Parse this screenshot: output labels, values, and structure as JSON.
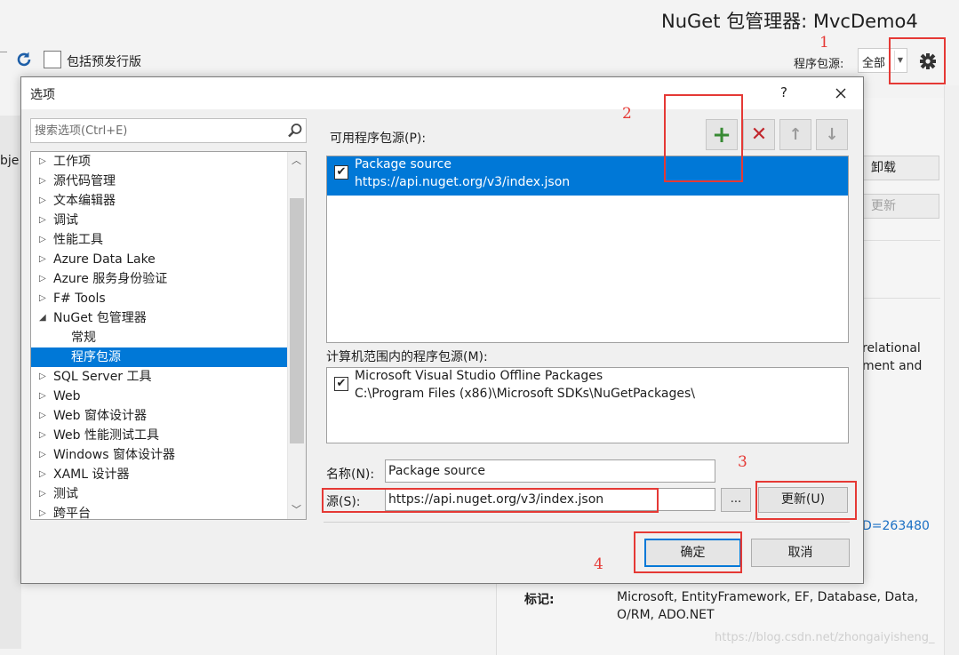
{
  "background": {
    "title": "NuGet 包管理器: MvcDemo4",
    "include_prerelease_label": "包括预发行版",
    "package_source_label": "程序包源:",
    "package_source_value": "全部",
    "left_text_fragment": "bje",
    "uninstall_label": "卸载",
    "update_label": "更新",
    "desc_line1": "relational",
    "desc_line2": "ment and",
    "link_fragment": "D=263480",
    "tags_label": "标记:",
    "tags_line1": "Microsoft, EntityFramework, EF, Database, Data,",
    "tags_line2": "O/RM, ADO.NET"
  },
  "dialog": {
    "title": "选项",
    "help": "?",
    "search_placeholder": "搜索选项(Ctrl+E)",
    "tree": [
      {
        "label": "工作项",
        "arrow": "▷",
        "child": false,
        "selected": false
      },
      {
        "label": "源代码管理",
        "arrow": "▷",
        "child": false,
        "selected": false
      },
      {
        "label": "文本编辑器",
        "arrow": "▷",
        "child": false,
        "selected": false
      },
      {
        "label": "调试",
        "arrow": "▷",
        "child": false,
        "selected": false
      },
      {
        "label": "性能工具",
        "arrow": "▷",
        "child": false,
        "selected": false
      },
      {
        "label": "Azure Data Lake",
        "arrow": "▷",
        "child": false,
        "selected": false
      },
      {
        "label": "Azure 服务身份验证",
        "arrow": "▷",
        "child": false,
        "selected": false
      },
      {
        "label": "F# Tools",
        "arrow": "▷",
        "child": false,
        "selected": false
      },
      {
        "label": "NuGet 包管理器",
        "arrow": "◢",
        "child": false,
        "selected": false
      },
      {
        "label": "常规",
        "arrow": "",
        "child": true,
        "selected": false
      },
      {
        "label": "程序包源",
        "arrow": "",
        "child": true,
        "selected": true
      },
      {
        "label": "SQL Server 工具",
        "arrow": "▷",
        "child": false,
        "selected": false
      },
      {
        "label": "Web",
        "arrow": "▷",
        "child": false,
        "selected": false
      },
      {
        "label": "Web 窗体设计器",
        "arrow": "▷",
        "child": false,
        "selected": false
      },
      {
        "label": "Web 性能测试工具",
        "arrow": "▷",
        "child": false,
        "selected": false
      },
      {
        "label": "Windows 窗体设计器",
        "arrow": "▷",
        "child": false,
        "selected": false
      },
      {
        "label": "XAML 设计器",
        "arrow": "▷",
        "child": false,
        "selected": false
      },
      {
        "label": "测试",
        "arrow": "▷",
        "child": false,
        "selected": false
      },
      {
        "label": "跨平台",
        "arrow": "▷",
        "child": false,
        "selected": false
      }
    ],
    "available_sources_label": "可用程序包源(P):",
    "available_sources": [
      {
        "name": "Package source",
        "url": "https://api.nuget.org/v3/index.json",
        "checked": true
      }
    ],
    "machine_sources_label": "计算机范围内的程序包源(M):",
    "machine_sources": [
      {
        "name": "Microsoft Visual Studio Offline Packages",
        "path": "C:\\Program Files (x86)\\Microsoft SDKs\\NuGetPackages\\",
        "checked": true
      }
    ],
    "name_label": "名称(N):",
    "name_value": "Package source",
    "source_label": "源(S):",
    "source_value": "https://api.nuget.org/v3/index.json",
    "browse_label": "...",
    "update_label": "更新(U)",
    "ok_label": "确定",
    "cancel_label": "取消"
  },
  "annotations": {
    "numbers": [
      "1",
      "2",
      "3",
      "4"
    ],
    "color": "#e53935"
  },
  "watermark": "https://blog.csdn.net/zhongaiyisheng_",
  "colors": {
    "selection": "#0078d7",
    "add_green": "#388a34",
    "remove_red": "#c1272d",
    "link_blue": "#1a6fc4"
  }
}
